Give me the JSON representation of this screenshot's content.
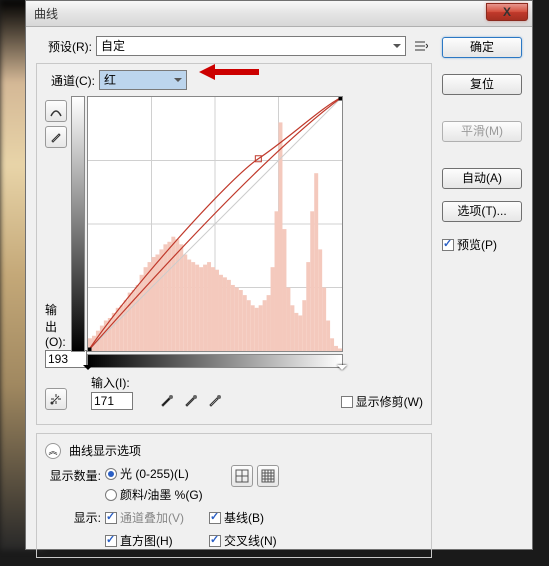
{
  "title": "曲线",
  "close_x": "X",
  "preset": {
    "label": "预设(R):",
    "value": "自定"
  },
  "channel": {
    "label": "通道(C):",
    "value": "红"
  },
  "buttons": {
    "ok": "确定",
    "reset": "复位",
    "smooth": "平滑(M)",
    "auto": "自动(A)",
    "options": "选项(T)..."
  },
  "preview": {
    "label": "预览(P)"
  },
  "io": {
    "out_label": "输出(O):",
    "out_value": "193",
    "in_label": "输入(I):",
    "in_value": "171"
  },
  "show_clip": "显示修剪(W)",
  "disp_options_label": "曲线显示选项",
  "show_amount": {
    "label": "显示数量:",
    "light": "光 (0-255)(L)",
    "pigment": "颜料/油墨 %(G)"
  },
  "show": {
    "label": "显示:",
    "channel_overlay": "通道叠加(V)",
    "baseline": "基线(B)",
    "histogram": "直方图(H)",
    "intersection": "交叉线(N)"
  },
  "chart_data": {
    "type": "curve",
    "channel": "red",
    "xrange": [
      0,
      255
    ],
    "yrange": [
      0,
      255
    ],
    "control_points": [
      {
        "in": 0,
        "out": 0
      },
      {
        "in": 171,
        "out": 193
      },
      {
        "in": 255,
        "out": 255
      }
    ],
    "active_point": {
      "in": 171,
      "out": 193
    },
    "histogram_peaks": [
      0.05,
      0.06,
      0.08,
      0.1,
      0.12,
      0.13,
      0.15,
      0.17,
      0.18,
      0.2,
      0.23,
      0.24,
      0.26,
      0.3,
      0.33,
      0.35,
      0.37,
      0.38,
      0.4,
      0.42,
      0.43,
      0.45,
      0.44,
      0.42,
      0.38,
      0.36,
      0.35,
      0.34,
      0.33,
      0.34,
      0.35,
      0.33,
      0.32,
      0.3,
      0.29,
      0.28,
      0.26,
      0.25,
      0.24,
      0.22,
      0.2,
      0.18,
      0.17,
      0.18,
      0.2,
      0.22,
      0.33,
      0.55,
      0.9,
      0.48,
      0.25,
      0.18,
      0.15,
      0.14,
      0.2,
      0.35,
      0.55,
      0.7,
      0.4,
      0.25,
      0.12,
      0.05,
      0.02,
      0.01
    ],
    "grid_divisions": 4
  }
}
